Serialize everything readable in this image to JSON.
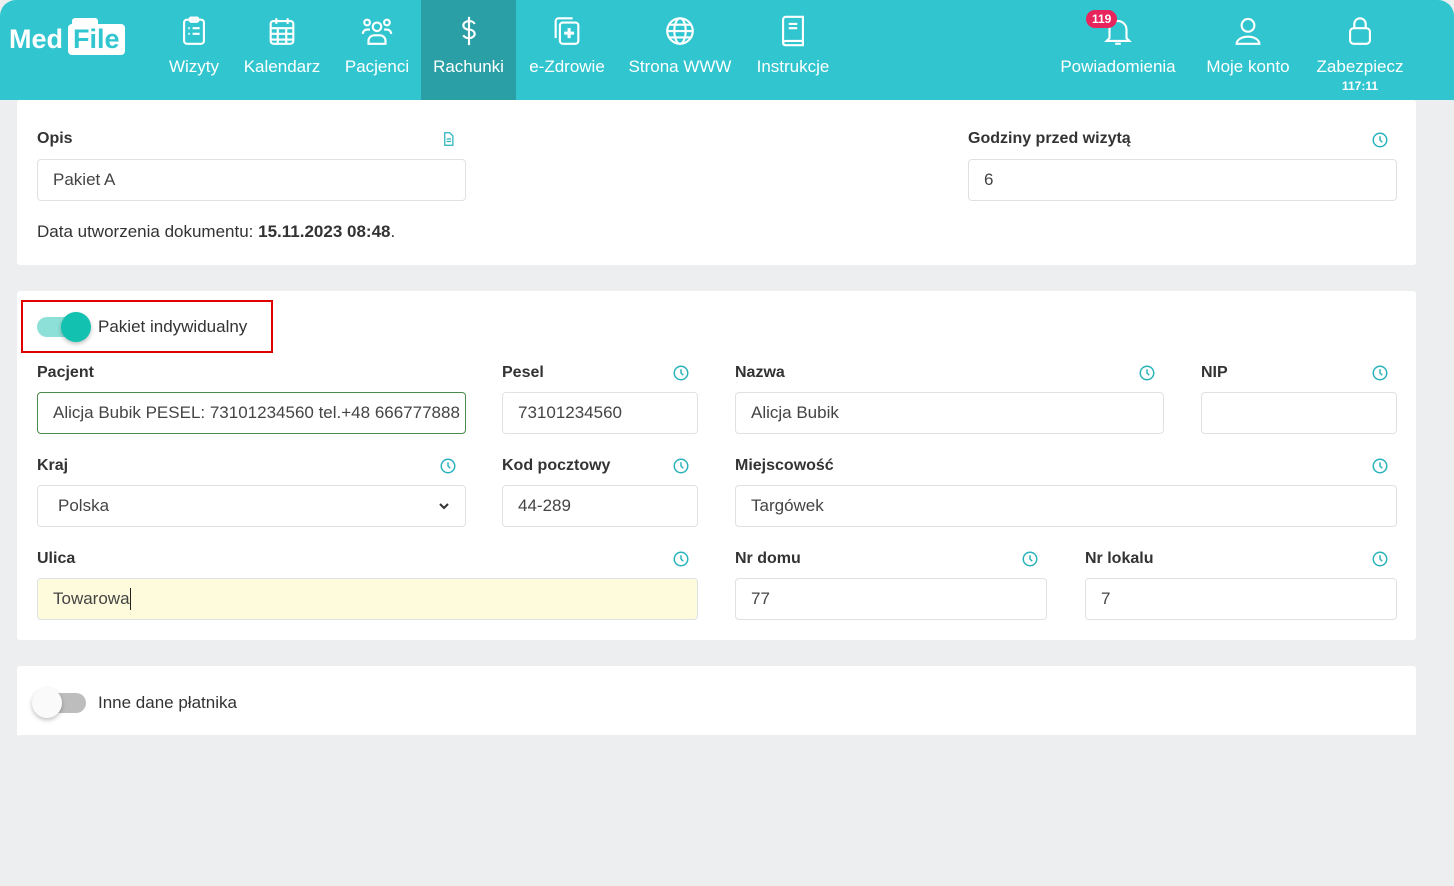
{
  "nav": {
    "logo": "MedFile",
    "logo_part1": "Med",
    "logo_part2": "File",
    "items": [
      {
        "label": "Wizyty",
        "icon": "clipboard-list-icon"
      },
      {
        "label": "Kalendarz",
        "icon": "calendar-icon"
      },
      {
        "label": "Pacjenci",
        "icon": "users-icon"
      },
      {
        "label": "Rachunki",
        "icon": "dollar-icon",
        "active": true
      },
      {
        "label": "e-Zdrowie",
        "icon": "medical-plus-icon"
      },
      {
        "label": "Strona WWW",
        "icon": "globe-icon"
      },
      {
        "label": "Instrukcje",
        "icon": "book-icon"
      }
    ],
    "right": [
      {
        "label": "Powiadomienia",
        "icon": "bell-icon",
        "badge": "119"
      },
      {
        "label": "Moje konto",
        "icon": "user-icon"
      },
      {
        "label": "Zabezpiecz",
        "icon": "lock-icon",
        "timer": "117:11"
      }
    ]
  },
  "colors": {
    "brand": "#31c6cf",
    "active": "#2aa0a6",
    "badge": "#e8245d",
    "toggle_on": "#13c1b0",
    "highlight": "#fefbdc",
    "focus_border": "#4a8a4a",
    "annotation": "#e00000"
  },
  "doc": {
    "opis_label": "Opis",
    "opis_value": "Pakiet A",
    "godziny_label": "Godziny przed wizytą",
    "godziny_value": "6",
    "created_prefix": "Data utworzenia dokumentu: ",
    "created_value": "15.11.2023 08:48",
    "created_suffix": "."
  },
  "individual": {
    "toggle_label": "Pakiet indywidualny",
    "toggle_on": true,
    "pacjent_label": "Pacjent",
    "pacjent_value": "Alicja Bubik PESEL: 73101234560 tel.+48 666777888",
    "pesel_label": "Pesel",
    "pesel_value": "73101234560",
    "nazwa_label": "Nazwa",
    "nazwa_value": "Alicja Bubik",
    "nip_label": "NIP",
    "nip_value": "",
    "kraj_label": "Kraj",
    "kraj_value": "Polska",
    "kod_label": "Kod pocztowy",
    "kod_value": "44-289",
    "miejscowosc_label": "Miejscowość",
    "miejscowosc_value": "Targówek",
    "ulica_label": "Ulica",
    "ulica_value": "Towarowa",
    "nrdomu_label": "Nr domu",
    "nrdomu_value": "77",
    "nrlokalu_label": "Nr lokalu",
    "nrlokalu_value": "7"
  },
  "payer": {
    "toggle_label": "Inne dane płatnika",
    "toggle_on": false
  }
}
